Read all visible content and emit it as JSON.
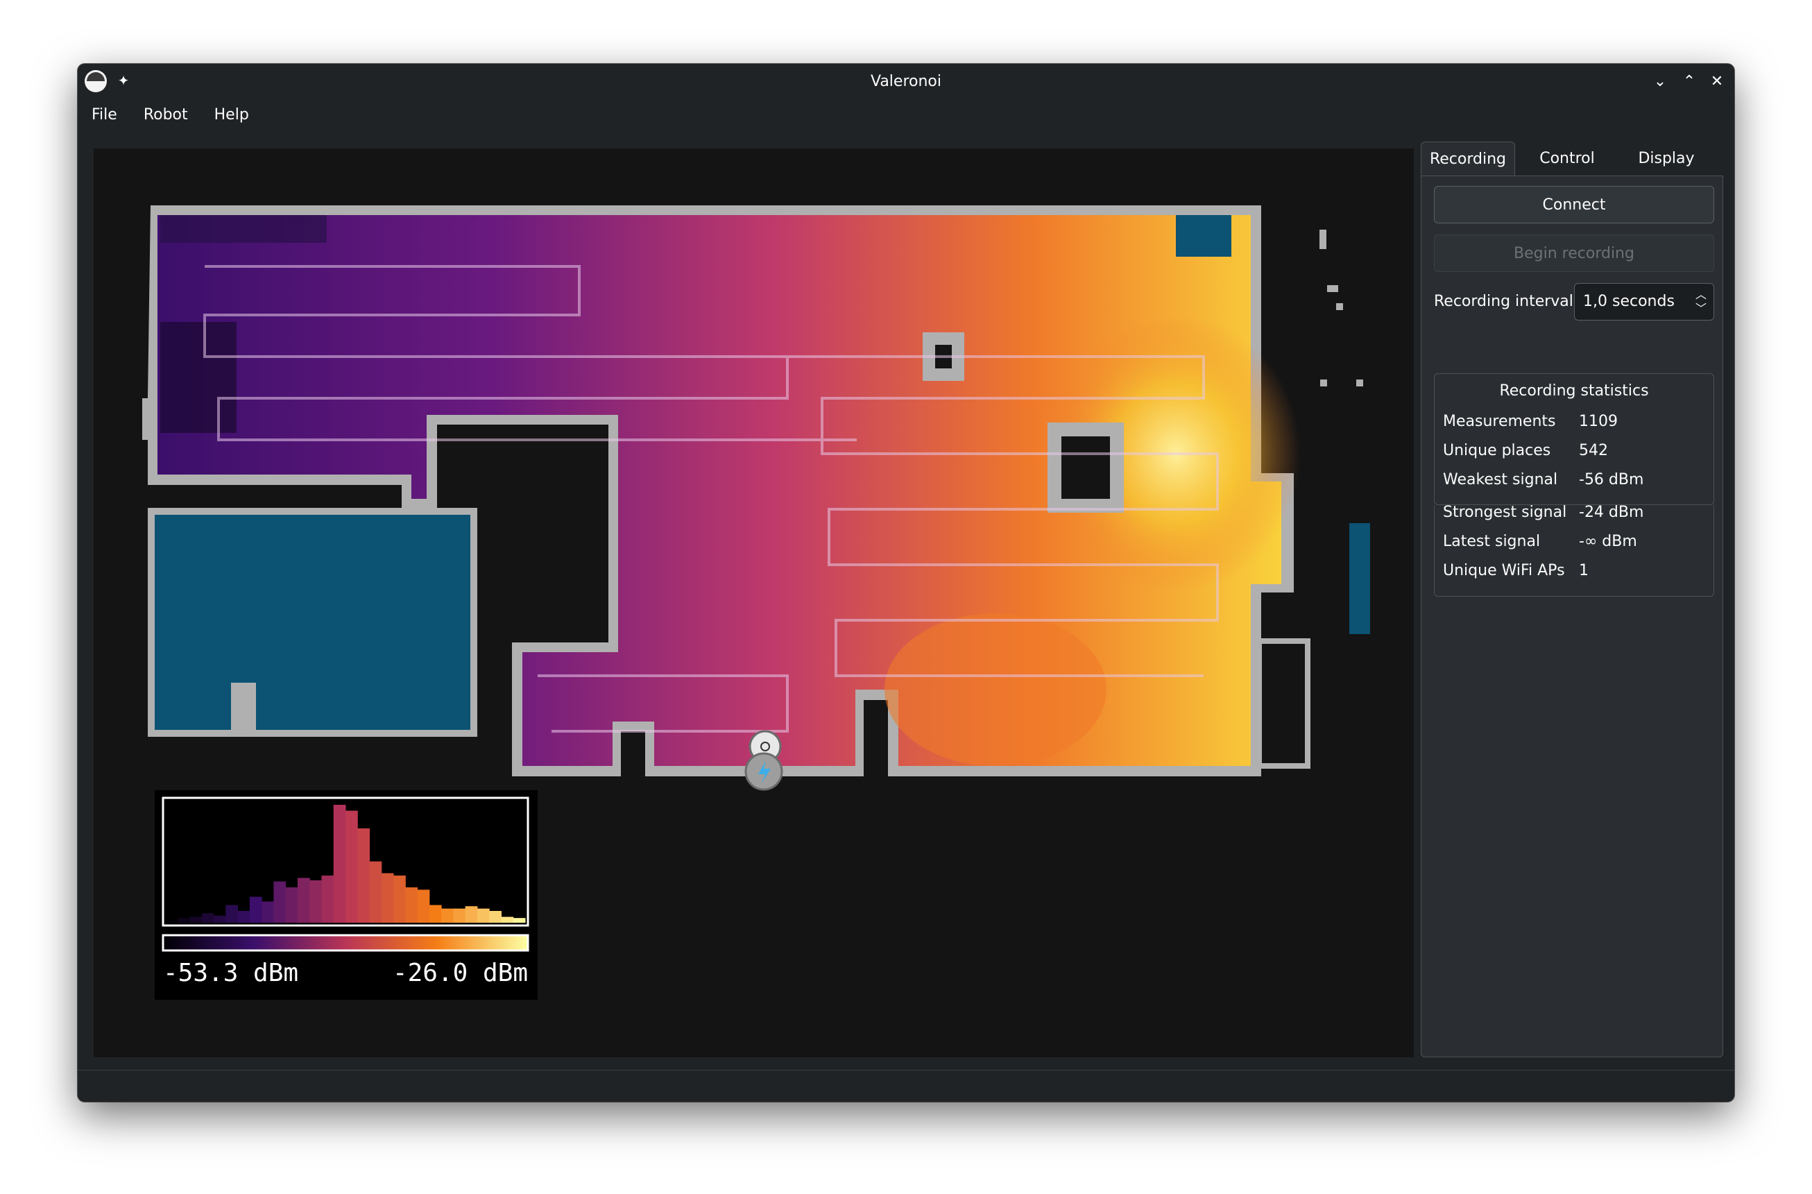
{
  "window": {
    "title": "Valeronoi"
  },
  "menu": {
    "items": [
      "File",
      "Robot",
      "Help"
    ]
  },
  "panel": {
    "tabs": [
      "Recording",
      "Control",
      "Display"
    ],
    "connect_label": "Connect",
    "begin_recording_label": "Begin recording",
    "interval_label": "Recording interval",
    "interval_value": "1,0 seconds",
    "stats": {
      "title": "Recording statistics",
      "rows": [
        {
          "label": "Measurements",
          "value": "1109"
        },
        {
          "label": "Unique places",
          "value": "542"
        },
        {
          "label": "Weakest signal",
          "value": "-56 dBm"
        },
        {
          "label": "Strongest signal",
          "value": "-24 dBm"
        },
        {
          "label": "Latest signal",
          "value": "-∞ dBm"
        },
        {
          "label": "Unique WiFi APs",
          "value": "1"
        }
      ]
    }
  },
  "legend": {
    "min_label": "-53.3 dBm",
    "max_label": "-26.0 dBm",
    "histogram": [
      0.02,
      0.04,
      0.05,
      0.08,
      0.06,
      0.15,
      0.1,
      0.22,
      0.18,
      0.35,
      0.3,
      0.38,
      0.36,
      0.4,
      1.0,
      0.95,
      0.8,
      0.52,
      0.42,
      0.4,
      0.3,
      0.28,
      0.15,
      0.12,
      0.12,
      0.14,
      0.12,
      0.1,
      0.05,
      0.04
    ]
  },
  "colors": {
    "accent": "#3daee9",
    "window_bg": "#202326",
    "map_bg": "#141414",
    "wall": "#b0b0b0",
    "floor_blue": "#0b5273"
  }
}
